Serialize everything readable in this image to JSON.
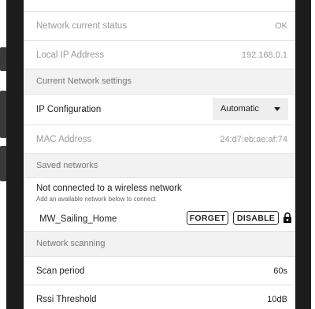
{
  "network_status": {
    "status_label": "Network current status",
    "status_value": "OK",
    "ip_label": "Local IP Address",
    "ip_value": "192.168.0.1"
  },
  "current_settings": {
    "header": "Current Network settings",
    "ip_config_label": "IP Configuration",
    "ip_config_value": "Automatic",
    "mac_label": "MAC Address",
    "mac_value": "24:d7:eb:ae:af:74"
  },
  "saved_networks": {
    "header": "Saved networks",
    "not_connected_title": "Not connected to a wireless network",
    "not_connected_subtitle": "Add an available network below to connect",
    "items": [
      {
        "ssid": "MW_Sailing_Home",
        "forget_label": "FORGET",
        "disable_label": "DISABLE",
        "icon": "lock-icon"
      }
    ]
  },
  "scanning": {
    "header": "Network scanning",
    "scan_period_label": "Scan period",
    "scan_period_value": "60s",
    "rssi_label": "Rssi Threshold",
    "rssi_value": "10dB"
  }
}
